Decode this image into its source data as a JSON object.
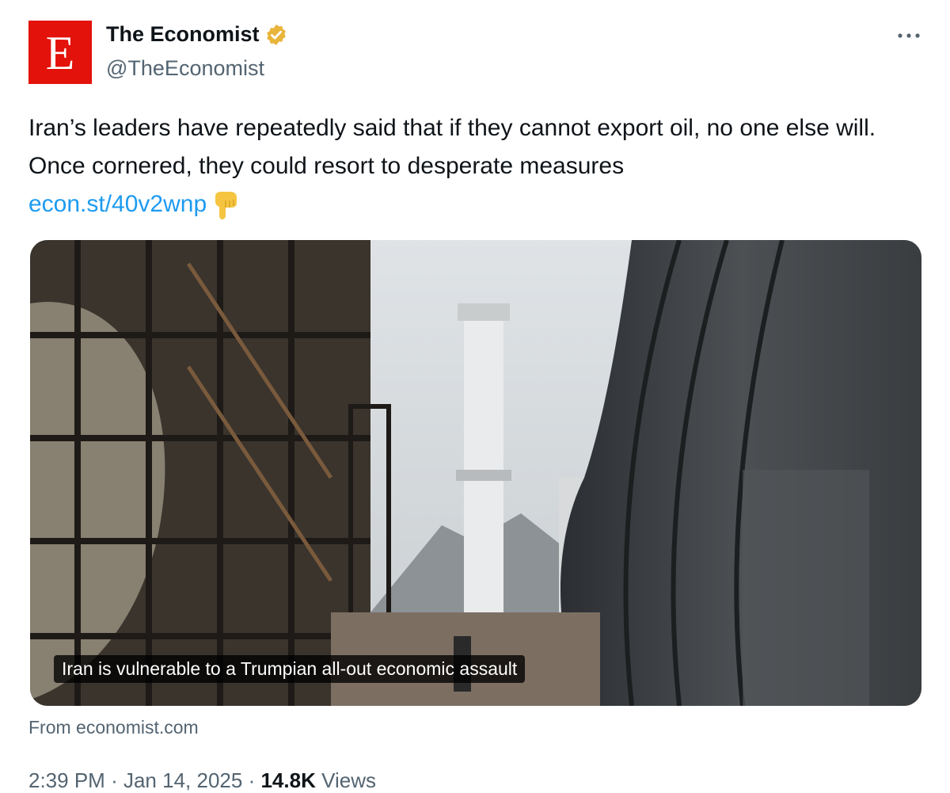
{
  "author": {
    "display_name": "The Economist",
    "handle": "@TheEconomist",
    "avatar_letter": "E",
    "avatar_color": "#e3120b",
    "verified_badge_color": "#e8b53a"
  },
  "menu": {
    "more_icon": "more-horizontal-icon"
  },
  "tweet": {
    "text_line": "Iran’s leaders have repeatedly said that if they cannot export oil, no one else will. Once cornered, they could resort to desperate measures",
    "link": "econ.st/40v2wnp",
    "emoji": "backhand-index-pointing-down"
  },
  "card": {
    "caption": "Iran is vulnerable to a Trumpian all-out economic assault",
    "source": "From economist.com"
  },
  "meta": {
    "time": "2:39 PM",
    "separator": "·",
    "date": "Jan 14, 2025",
    "views_count": "14.8K",
    "views_label": "Views"
  },
  "colors": {
    "link": "#1d9bf0",
    "muted": "#536471",
    "text": "#0f1419"
  }
}
